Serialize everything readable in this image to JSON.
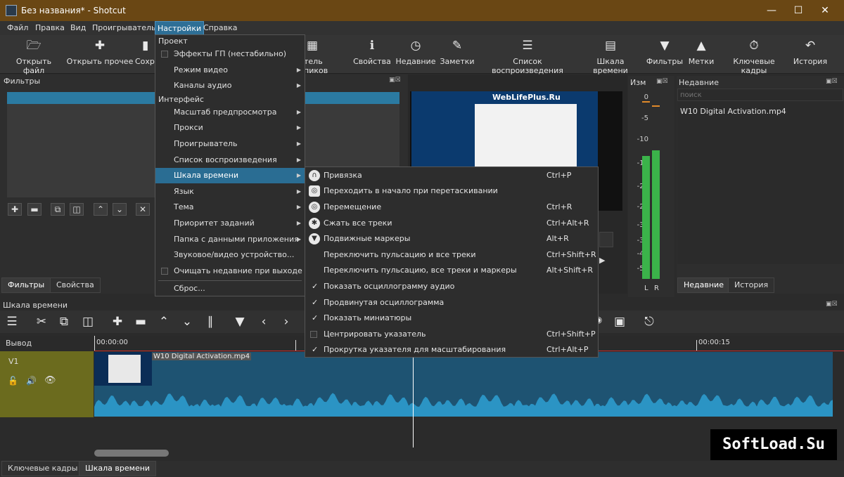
{
  "window": {
    "title": "Без названия* - Shotcut"
  },
  "menubar": [
    "Файл",
    "Правка",
    "Вид",
    "Проигрыватель",
    "Настройки",
    "Справка"
  ],
  "toolbar": {
    "items": [
      "Открыть файл",
      "Открыть прочее",
      "Сохр",
      "тель пиков",
      "Свойства",
      "Недавние",
      "Заметки",
      "Список воспроизведения",
      "Шкала времени",
      "Фильтры",
      "Метки",
      "Ключевые кадры",
      "История"
    ]
  },
  "filters_panel": {
    "title": "Фильтры",
    "tabs": [
      "Фильтры",
      "Свойства"
    ]
  },
  "meter": {
    "title": "Изм",
    "scale": [
      "0",
      "-5",
      "-10",
      "-15",
      "-20",
      "-25",
      "-30",
      "-35",
      "-40",
      "-50"
    ],
    "channels": [
      "L",
      "R"
    ],
    "level_left": 0.7,
    "level_right": 0.73,
    "accent": "#3bb34a"
  },
  "player": {
    "site": "WebLifePlus.Ru"
  },
  "recent": {
    "title": "Недавние",
    "search_placeholder": "поиск",
    "items": [
      "W10 Digital Activation.mp4"
    ],
    "tabs": [
      "Недавние",
      "История"
    ]
  },
  "timeline": {
    "title": "Шкала времени",
    "output_label": "Вывод",
    "track": "V1",
    "ruler": [
      "00:00:00",
      "00:00:15"
    ],
    "clip": "W10 Digital Activation.mp4",
    "bottom_tabs": [
      "Ключевые кадры",
      "Шкала времени"
    ]
  },
  "settings_menu": {
    "sections": [
      "Проект",
      "Интерфейс"
    ],
    "project_items": [
      {
        "label": "Эффекты ГП (нестабильно)",
        "checkbox": true,
        "arrow": false
      },
      {
        "label": "Режим видео",
        "checkbox": false,
        "arrow": true
      },
      {
        "label": "Каналы аудио",
        "checkbox": false,
        "arrow": true
      }
    ],
    "interface_items": [
      {
        "label": "Масштаб предпросмотра",
        "checkbox": false,
        "arrow": true
      },
      {
        "label": "Прокси",
        "checkbox": false,
        "arrow": true
      },
      {
        "label": "Проигрыватель",
        "checkbox": false,
        "arrow": true
      },
      {
        "label": "Список воспроизведения",
        "checkbox": false,
        "arrow": true
      },
      {
        "label": "Шкала времени",
        "checkbox": false,
        "arrow": true,
        "highlight": true
      },
      {
        "label": "Язык",
        "checkbox": false,
        "arrow": true
      },
      {
        "label": "Тема",
        "checkbox": false,
        "arrow": true
      },
      {
        "label": "Приоритет заданий",
        "checkbox": false,
        "arrow": true
      },
      {
        "label": "Папка с данными приложения",
        "checkbox": false,
        "arrow": true
      },
      {
        "label": "Звуковое/видео устройство...",
        "checkbox": false,
        "arrow": false
      },
      {
        "label": "Очищать недавние при выходе",
        "checkbox": true,
        "arrow": false
      },
      {
        "label": "Сброс...",
        "checkbox": false,
        "arrow": false
      }
    ]
  },
  "timeline_submenu": [
    {
      "label": "Привязка",
      "shortcut": "Ctrl+P",
      "mark": "icon"
    },
    {
      "label": "Переходить в начало при перетаскивании",
      "shortcut": "",
      "mark": "icon"
    },
    {
      "label": "Перемещение",
      "shortcut": "Ctrl+R",
      "mark": "icon"
    },
    {
      "label": "Сжать все треки",
      "shortcut": "Ctrl+Alt+R",
      "mark": "icon"
    },
    {
      "label": "Подвижные маркеры",
      "shortcut": "Alt+R",
      "mark": "icon"
    },
    {
      "label": "Переключить пульсацию и все треки",
      "shortcut": "Ctrl+Shift+R",
      "mark": "none"
    },
    {
      "label": "Переключить пульсацию, все треки и маркеры",
      "shortcut": "Alt+Shift+R",
      "mark": "none"
    },
    {
      "label": "Показать осциллограмму аудио",
      "shortcut": "",
      "mark": "check"
    },
    {
      "label": "Продвинутая осциллограмма",
      "shortcut": "",
      "mark": "check"
    },
    {
      "label": "Показать миниатюры",
      "shortcut": "",
      "mark": "check"
    },
    {
      "label": "Центрировать указатель",
      "shortcut": "Ctrl+Shift+P",
      "mark": "box"
    },
    {
      "label": "Прокрутка указателя для масштабирования",
      "shortcut": "Ctrl+Alt+P",
      "mark": "check"
    }
  ],
  "watermark": "SoftLoad.Su"
}
